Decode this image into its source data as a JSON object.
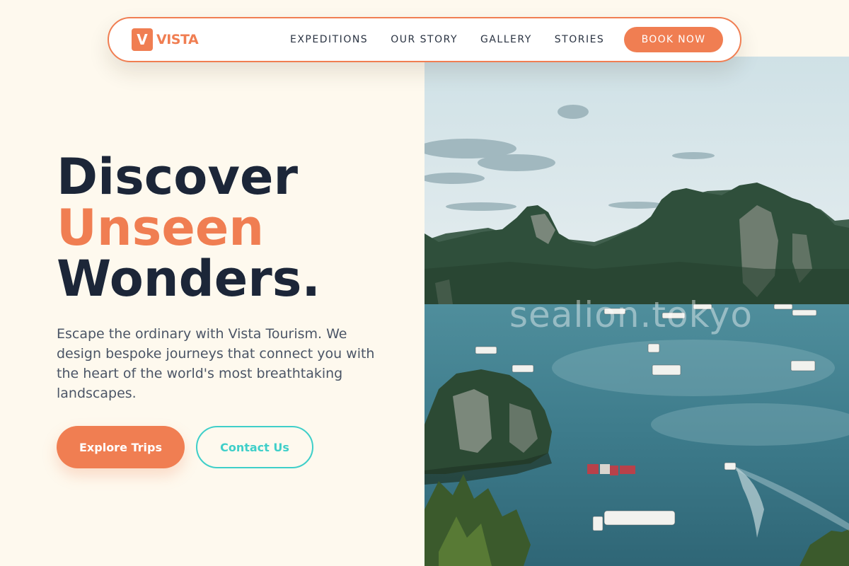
{
  "brand": {
    "mark": "V",
    "name": "VISTA"
  },
  "nav": {
    "links": [
      {
        "label": "EXPEDITIONS"
      },
      {
        "label": "OUR STORY"
      },
      {
        "label": "GALLERY"
      },
      {
        "label": "STORIES"
      }
    ],
    "cta": "BOOK NOW"
  },
  "hero": {
    "title_line1": "Discover",
    "title_accent": "Unseen",
    "title_line3": "Wonders.",
    "description": "Escape the ordinary with Vista Tourism. We design bespoke journeys that connect you with the heart of the world's most breathtaking landscapes.",
    "primary_button": "Explore Trips",
    "secondary_button": "Contact Us"
  },
  "image": {
    "watermark": "sealion.tokyo"
  },
  "colors": {
    "background": "#fef9ee",
    "accent": "#f07e52",
    "teal": "#3fcfc9",
    "heading": "#1c2638",
    "body_text": "#4b5566"
  }
}
